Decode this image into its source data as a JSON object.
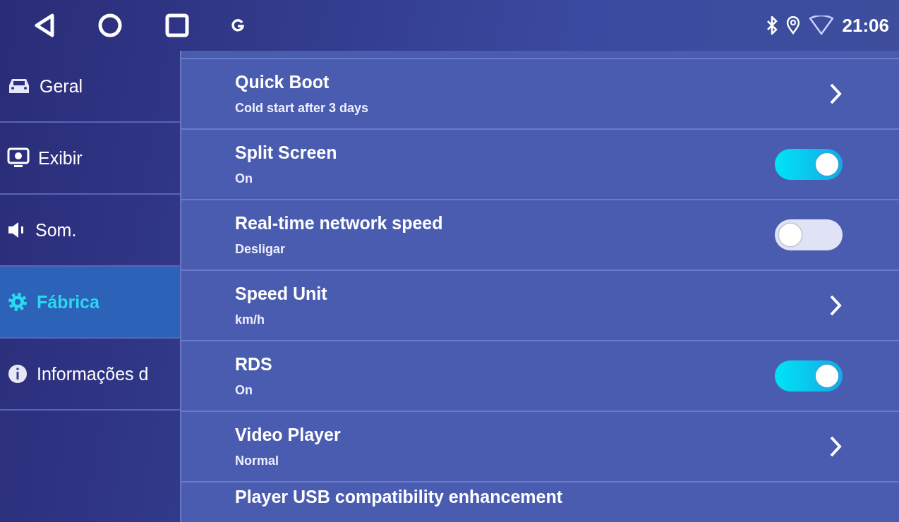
{
  "status_bar": {
    "time": "21:06"
  },
  "sidebar": {
    "items": [
      {
        "label": "Geral",
        "kind": "car",
        "selected": false
      },
      {
        "label": "Exibir",
        "kind": "display",
        "selected": false
      },
      {
        "label": "Som.",
        "kind": "speaker",
        "selected": false
      },
      {
        "label": "Fábrica",
        "kind": "gear",
        "selected": true
      },
      {
        "label": "Informações d",
        "kind": "info",
        "selected": false
      }
    ]
  },
  "settings": [
    {
      "kind": "link",
      "title": "Quick Boot",
      "value": "Cold start after 3 days"
    },
    {
      "kind": "toggle",
      "title": "Split Screen",
      "value": "On",
      "on": true
    },
    {
      "kind": "toggle",
      "title": "Real-time network speed",
      "value": "Desligar",
      "on": false
    },
    {
      "kind": "link",
      "title": "Speed Unit",
      "value": "km/h"
    },
    {
      "kind": "toggle",
      "title": "RDS",
      "value": "On",
      "on": true
    },
    {
      "kind": "link",
      "title": "Video Player",
      "value": "Normal"
    },
    {
      "kind": "partial",
      "title": "Player USB compatibility enhancement"
    }
  ]
}
